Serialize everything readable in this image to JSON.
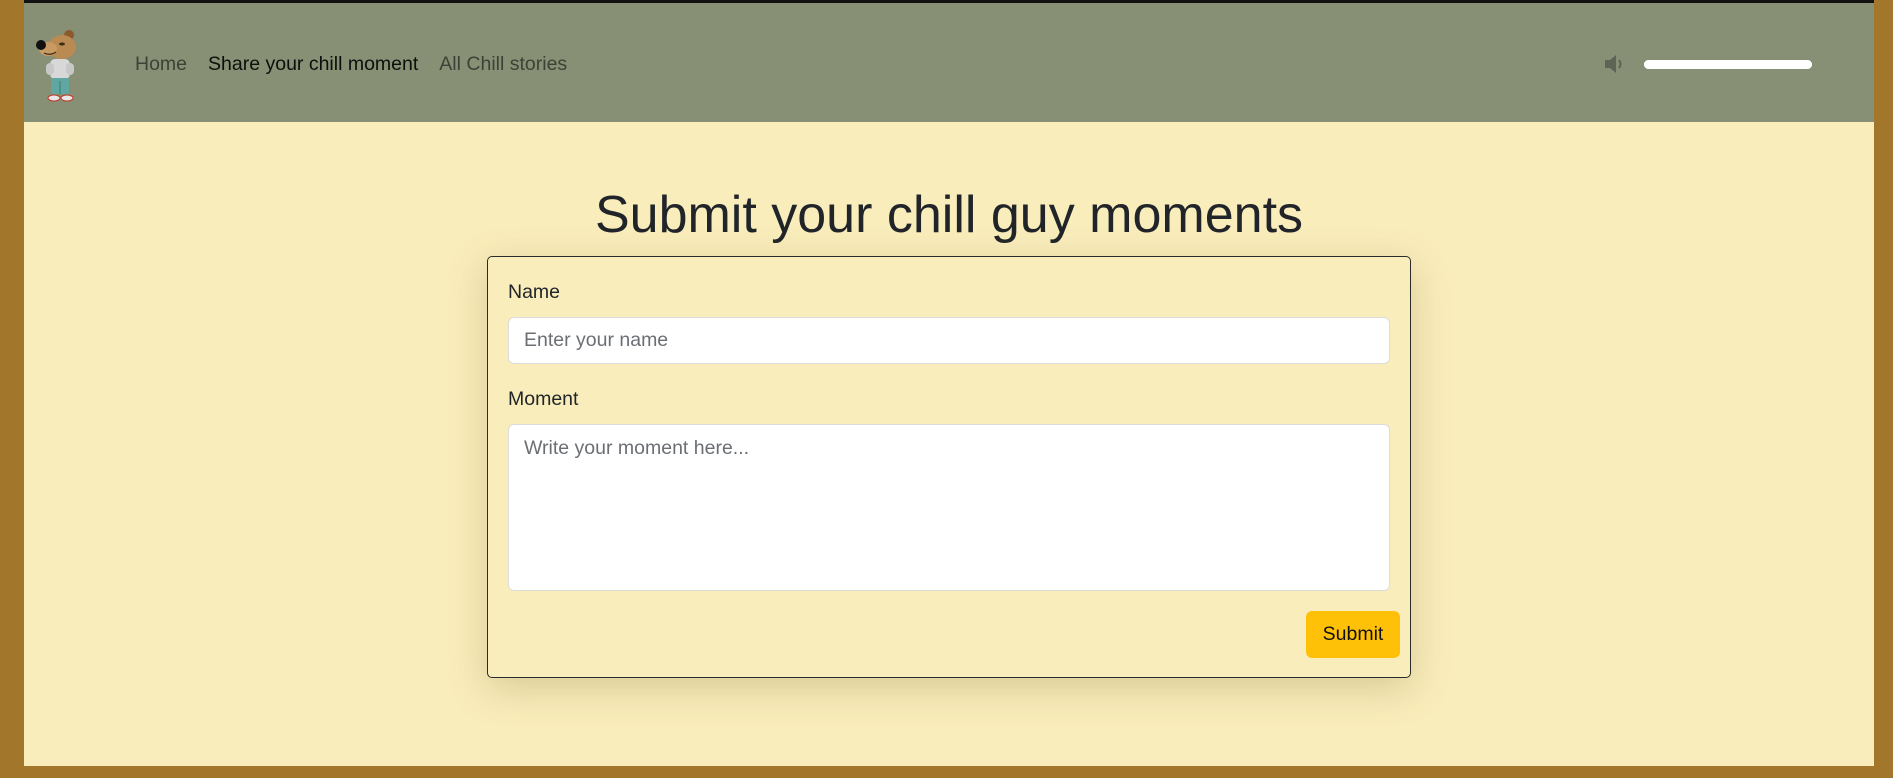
{
  "nav": {
    "logo_icon": "chill-guy-dog-logo",
    "links": [
      {
        "label": "Home",
        "active": false
      },
      {
        "label": "Share your chill moment",
        "active": true
      },
      {
        "label": "All Chill stories",
        "active": false
      }
    ],
    "volume": {
      "icon": "speaker-icon",
      "level": 1.0
    }
  },
  "main": {
    "title": "Submit your chill guy moments"
  },
  "form": {
    "name_label": "Name",
    "name_placeholder": "Enter your name",
    "name_value": "",
    "moment_label": "Moment",
    "moment_placeholder": "Write your moment here...",
    "moment_value": "",
    "submit_label": "Submit"
  },
  "colors": {
    "navbar": "#878f75",
    "page_background": "#f9edbb",
    "outer_background": "#a2772c",
    "submit_button": "#ffc107"
  }
}
